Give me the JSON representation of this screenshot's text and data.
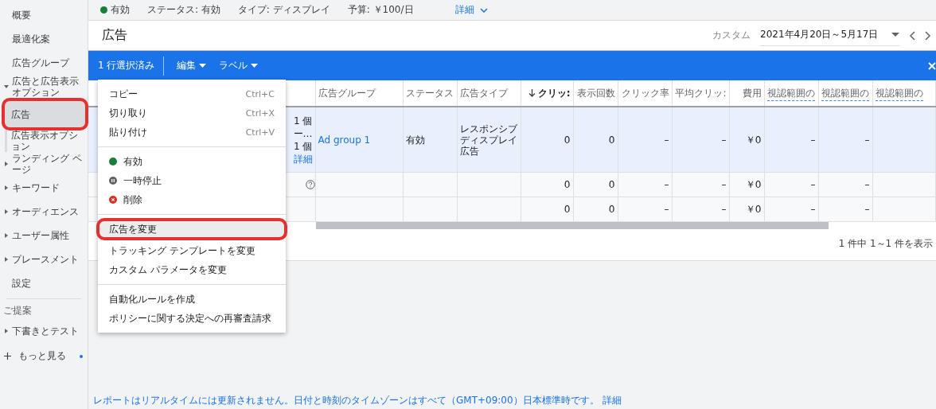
{
  "sidebar": {
    "items": [
      {
        "label": "概要",
        "selected": false
      },
      {
        "label": "最適化案",
        "selected": false
      },
      {
        "label": "広告グループ",
        "selected": false
      },
      {
        "label": "広告と広告表示オプション",
        "selected": false,
        "expanded": true,
        "children": [
          {
            "label": "広告",
            "selected": true
          },
          {
            "label": "広告表示オプション",
            "selected": false
          }
        ]
      },
      {
        "label": "ランディング ページ",
        "selected": false,
        "expanded": false
      },
      {
        "label": "キーワード",
        "selected": false,
        "expanded": false
      },
      {
        "label": "オーディエンス",
        "selected": false,
        "expanded": false
      },
      {
        "label": "ユーザー属性",
        "selected": false,
        "expanded": false
      },
      {
        "label": "プレースメント",
        "selected": false,
        "expanded": false
      },
      {
        "label": "設定",
        "selected": false
      }
    ],
    "section_label": "ご提案",
    "suggestions": [
      {
        "label": "下書きとテスト",
        "selected": false,
        "expanded": false
      }
    ],
    "more": {
      "label": "もっと見る",
      "notification": true
    }
  },
  "summary_bar": {
    "status": {
      "label": "有効",
      "color": "#188038"
    },
    "items": [
      "ステータス: 有効",
      "タイプ: ディスプレイ",
      "予算: ￥100/日"
    ],
    "details_link": "詳細"
  },
  "header": {
    "title": "広告",
    "date_label": "カスタム",
    "date_range": "2021年4月20日～5月17日"
  },
  "selection_bar": {
    "count_label": "1 行選択済み",
    "menus": [
      "編集",
      "ラベル"
    ]
  },
  "table": {
    "columns": [
      {
        "label": "広告グループ",
        "kind": "text"
      },
      {
        "label": "ステータス",
        "kind": "text"
      },
      {
        "label": "広告タイプ",
        "kind": "text"
      },
      {
        "label": "クリッ:",
        "kind": "sorted"
      },
      {
        "label": "表示回数",
        "kind": "metric"
      },
      {
        "label": "クリック率",
        "kind": "metric"
      },
      {
        "label": "平均クリッ:",
        "kind": "metric"
      },
      {
        "label": "費用",
        "kind": "metric"
      },
      {
        "label": "視認範囲の",
        "kind": "hint"
      },
      {
        "label": "視認範囲の",
        "kind": "hint"
      },
      {
        "label": "視認範囲の",
        "kind": "hint"
      }
    ],
    "rows": [
      {
        "kind": "ad",
        "selected": true,
        "ad_lines": [
          "1 個",
          "ー…",
          "1 個"
        ],
        "ad_link": "詳細",
        "help_icon": false,
        "cells": [
          "Ad group 1",
          "有効",
          "レスポンシブディスプレイ広告",
          "0",
          "0",
          "–",
          "–",
          "￥0",
          "–",
          "–",
          ""
        ]
      },
      {
        "kind": "total",
        "selected": false,
        "ad_lines": [],
        "help_icon": true,
        "cells": [
          "",
          "",
          "",
          "0",
          "0",
          "–",
          "–",
          "￥0",
          "–",
          "–",
          ""
        ]
      },
      {
        "kind": "total",
        "selected": false,
        "ad_lines": [],
        "help_icon": false,
        "cells": [
          "",
          "",
          "",
          "0",
          "0",
          "–",
          "–",
          "￥0",
          "–",
          "–",
          ""
        ]
      }
    ],
    "pagination": "1 件中 1～1 件を表示"
  },
  "menu": {
    "groups": [
      [
        {
          "label": "コピー",
          "shortcut": "Ctrl+C",
          "kind": "action",
          "highlighted": false
        },
        {
          "label": "切り取り",
          "shortcut": "Ctrl+X",
          "kind": "action",
          "highlighted": false
        },
        {
          "label": "貼り付け",
          "shortcut": "Ctrl+V",
          "kind": "action",
          "highlighted": false
        }
      ],
      [
        {
          "label": "有効",
          "kind": "enabled",
          "color": "#188038",
          "highlighted": false
        },
        {
          "label": "一時停止",
          "kind": "paused",
          "color": "#5f6368",
          "highlighted": false
        },
        {
          "label": "削除",
          "kind": "removed",
          "color": "#d93025",
          "highlighted": false
        }
      ],
      [
        {
          "label": "広告を変更",
          "kind": "action",
          "highlighted": true
        },
        {
          "label": "トラッキング テンプレートを変更",
          "kind": "action",
          "highlighted": false
        },
        {
          "label": "カスタム パラメータを変更",
          "kind": "action",
          "highlighted": false
        }
      ],
      [
        {
          "label": "自動化ルールを作成",
          "kind": "action",
          "highlighted": false
        },
        {
          "label": "ポリシーに関する決定への再審査請求",
          "kind": "action",
          "highlighted": false
        }
      ]
    ]
  },
  "notice": {
    "text": "レポートはリアルタイムには更新されません。日付と時刻のタイムゾーンはすべて（GMT+09:00）日本標準時です。",
    "link": "詳細"
  }
}
